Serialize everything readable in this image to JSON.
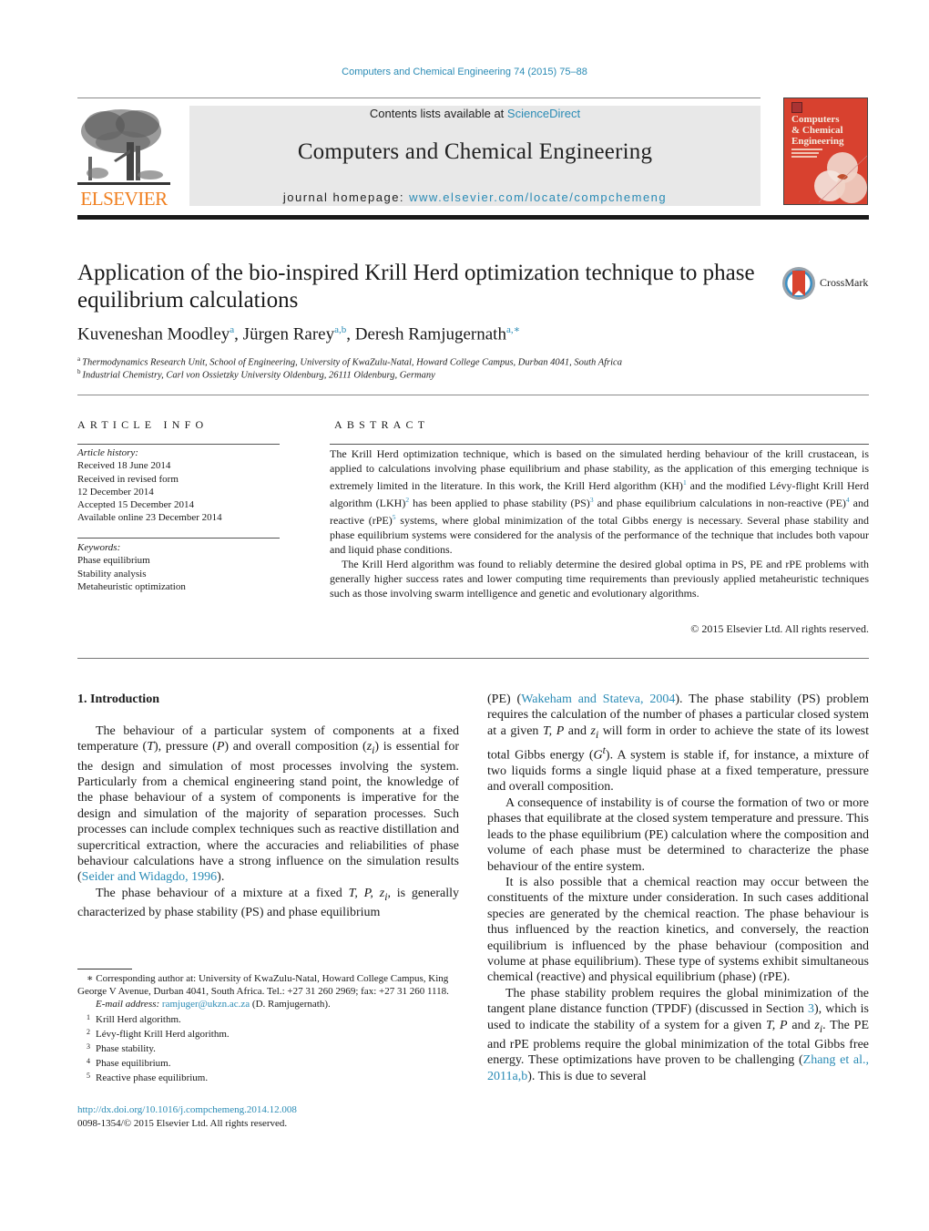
{
  "running_head": "Computers and Chemical Engineering 74 (2015) 75–88",
  "masthead": {
    "publisher_logo_text": "ELSEVIER",
    "contents_prefix": "Contents lists available at ",
    "contents_link": "ScienceDirect",
    "journal_name": "Computers and Chemical Engineering",
    "homepage_prefix": "journal homepage: ",
    "homepage_link": "www.elsevier.com/locate/compchemeng",
    "cover_title_lines": [
      "Computers",
      "& Chemical",
      "Engineering"
    ],
    "colors": {
      "link": "#2a8bb5",
      "elsevier_orange": "#f07f1f",
      "cover_red": "#d8412f",
      "band_gray": "#e8e8e8"
    }
  },
  "article": {
    "title": "Application of the bio-inspired Krill Herd optimization technique to phase equilibrium calculations",
    "crossmark_label": "CrossMark",
    "authors": [
      {
        "name": "Kuveneshan Moodley",
        "marks": "a"
      },
      {
        "name": "Jürgen Rarey",
        "marks": "a,b"
      },
      {
        "name": "Deresh Ramjugernath",
        "marks": "a,∗"
      }
    ],
    "affiliations": [
      {
        "mark": "a",
        "text": "Thermodynamics Research Unit, School of Engineering, University of KwaZulu-Natal, Howard College Campus, Durban 4041, South Africa"
      },
      {
        "mark": "b",
        "text": "Industrial Chemistry, Carl von Ossietzky University Oldenburg, 26111 Oldenburg, Germany"
      }
    ]
  },
  "article_info": {
    "heading": "ARTICLE INFO",
    "history_label": "Article history:",
    "history": [
      "Received 18 June 2014",
      "Received in revised form",
      "12 December 2014",
      "Accepted 15 December 2014",
      "Available online 23 December 2014"
    ],
    "keywords_label": "Keywords:",
    "keywords": [
      "Phase equilibrium",
      "Stability analysis",
      "Metaheuristic optimization"
    ]
  },
  "abstract": {
    "heading": "ABSTRACT",
    "p1": {
      "t1": "The Krill Herd optimization technique, which is based on the simulated herding behaviour of the krill crustacean, is applied to calculations involving phase equilibrium and phase stability, as the application of this emerging technique is extremely limited in the literature. In this work, the Krill Herd algorithm (KH)",
      "f1": "1",
      "t2": " and the modified Lévy-flight Krill Herd algorithm (LKH)",
      "f2": "2",
      "t3": " has been applied to phase stability (PS)",
      "f3": "3",
      "t4": " and phase equilibrium calculations in non-reactive (PE)",
      "f4": "4",
      "t5": " and reactive (rPE)",
      "f5": "5",
      "t6": " systems, where global minimization of the total Gibbs energy is necessary. Several phase stability and phase equilibrium systems were considered for the analysis of the performance of the technique that includes both vapour and liquid phase conditions."
    },
    "p2": "The Krill Herd algorithm was found to reliably determine the desired global optima in PS, PE and rPE problems with generally higher success rates and lower computing time requirements than previously applied metaheuristic techniques such as those involving swarm intelligence and genetic and evolutionary algorithms.",
    "copyright": "© 2015 Elsevier Ltd. All rights reserved."
  },
  "body": {
    "section_heading": "1.  Introduction",
    "left_p1": {
      "t1": "The behaviour of a particular system of components at a fixed temperature (",
      "v_T": "T",
      "t2": "), pressure (",
      "v_P": "P",
      "t3": ") and overall composition (",
      "v_z": "z",
      "v_sub": "i",
      "t4": ") is essential for the design and simulation of most processes involving the system. Particularly from a chemical engineering stand point, the knowledge of the phase behaviour of a system of components is imperative for the design and simulation of the majority of separation processes. Such processes can include complex techniques such as reactive distillation and supercritical extraction, where the accuracies and reliabilities of phase behaviour calculations have a strong influence on the simulation results (",
      "cite": "Seider and Widagdo, 1996",
      "t5": ")."
    },
    "left_p2": {
      "t1": "The phase behaviour of a mixture at a fixed ",
      "vars": "T, P, z",
      "v_sub": "i",
      "t2": ", is generally characterized by phase stability (PS) and phase equilibrium"
    },
    "right_p1": {
      "t1": "(PE) (",
      "cite": "Wakeham and Stateva, 2004",
      "t2": "). The phase stability (PS) problem requires the calculation of the number of phases a particular closed system at a given ",
      "vars": "T, P",
      "t3": " and ",
      "v_z": "z",
      "v_sub": "i",
      "t4": " will form in order to achieve the state of its lowest total Gibbs energy (",
      "v_G": "G",
      "v_sup": "t",
      "t5": "). A system is stable if, for instance, a mixture of two liquids forms a single liquid phase at a fixed temperature, pressure and overall composition."
    },
    "right_p2": "A consequence of instability is of course the formation of two or more phases that equilibrate at the closed system temperature and pressure. This leads to the phase equilibrium (PE) calculation where the composition and volume of each phase must be determined to characterize the phase behaviour of the entire system.",
    "right_p3": "It is also possible that a chemical reaction may occur between the constituents of the mixture under consideration. In such cases additional species are generated by the chemical reaction. The phase behaviour is thus influenced by the reaction kinetics, and conversely, the reaction equilibrium is influenced by the phase behaviour (composition and volume at phase equilibrium). These type of systems exhibit simultaneous chemical (reactive) and physical equilibrium (phase) (rPE).",
    "right_p4": {
      "t1": "The phase stability problem requires the global minimization of the tangent plane distance function (TPDF) (discussed in Section ",
      "section_ref": "3",
      "t2": "), which is used to indicate the stability of a system for a given ",
      "vars": "T, P",
      "t3": " and ",
      "v_z": "z",
      "v_sub": "i",
      "t4": ". The PE and rPE problems require the global minimization of the total Gibbs free energy. These optimizations have proven to be challenging (",
      "cite": "Zhang et al., 2011a,b",
      "t5": "). This is due to several"
    }
  },
  "footnotes": {
    "corresponding": "∗  Corresponding author at: University of KwaZulu-Natal, Howard College Campus, King George V Avenue, Durban 4041, South Africa. Tel.: +27 31 260 2969; fax: +27 31 260 1118.",
    "email_label": "E-mail address:",
    "email": "ramjuger@ukzn.ac.za",
    "email_suffix": " (D. Ramjugernath).",
    "notes": [
      {
        "num": "1",
        "text": "Krill Herd algorithm."
      },
      {
        "num": "2",
        "text": "Lévy-flight Krill Herd algorithm."
      },
      {
        "num": "3",
        "text": "Phase stability."
      },
      {
        "num": "4",
        "text": "Phase equilibrium."
      },
      {
        "num": "5",
        "text": "Reactive phase equilibrium."
      }
    ]
  },
  "doi": {
    "link": "http://dx.doi.org/10.1016/j.compchemeng.2014.12.008",
    "issn_line": "0098-1354/© 2015 Elsevier Ltd. All rights reserved."
  }
}
